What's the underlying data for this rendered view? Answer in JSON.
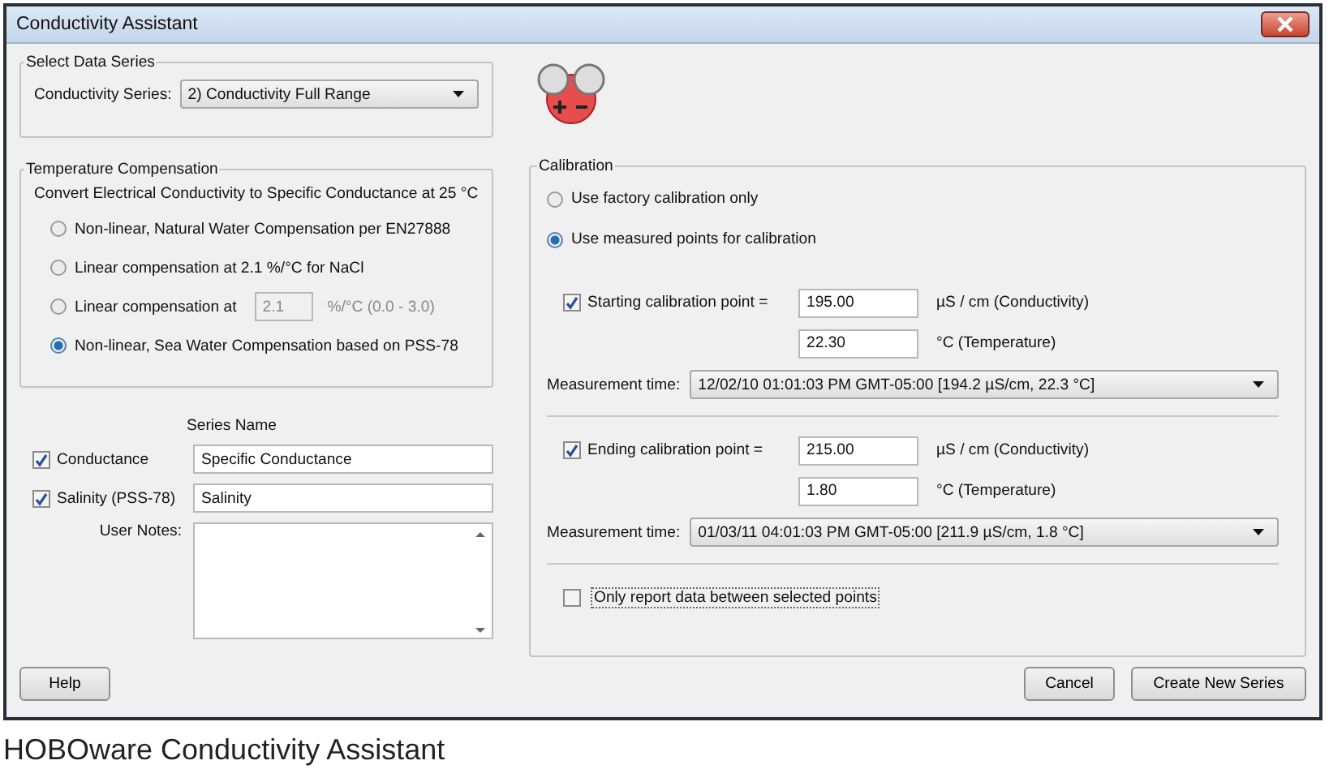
{
  "window": {
    "title": "Conductivity Assistant"
  },
  "select_data_series": {
    "title": "Select Data Series",
    "label": "Conductivity Series:",
    "value": "2) Conductivity Full Range"
  },
  "temperature_compensation": {
    "title": "Temperature Compensation",
    "description": "Convert Electrical Conductivity to Specific Conductance at 25 °C",
    "options": [
      {
        "kind": "plain",
        "label": "Non-linear, Natural Water Compensation per EN27888",
        "selected": false
      },
      {
        "kind": "plain",
        "label": "Linear compensation at 2.1 %/°C for NaCl",
        "selected": false
      },
      {
        "kind": "input",
        "label": "Linear compensation at",
        "value": "2.1",
        "unit": "%/°C  (0.0 - 3.0)",
        "disabled": true,
        "selected": false
      },
      {
        "kind": "plain",
        "label": "Non-linear, Sea Water Compensation based on PSS-78",
        "selected": true
      }
    ]
  },
  "series": {
    "heading": "Series Name",
    "rows": [
      {
        "label": "Conductance",
        "checked": true,
        "value": "Specific Conductance"
      },
      {
        "label": "Salinity (PSS-78)",
        "checked": true,
        "value": "Salinity"
      }
    ],
    "notes_label": "User Notes:"
  },
  "calibration": {
    "title": "Calibration",
    "modes": [
      {
        "label": "Use factory calibration only",
        "selected": false
      },
      {
        "label": "Use measured points for calibration",
        "selected": true
      }
    ],
    "points": [
      {
        "label": "Starting calibration point =",
        "checked": true,
        "conductivity": "195.00",
        "conductivity_unit": "µS / cm (Conductivity)",
        "temperature": "22.30",
        "temperature_unit": "°C (Temperature)",
        "time_label": "Measurement time:",
        "time": "12/02/10 01:01:03 PM GMT-05:00 [194.2 µS/cm, 22.3 °C]"
      },
      {
        "label": "Ending calibration point =",
        "checked": true,
        "conductivity": "215.00",
        "conductivity_unit": "µS / cm (Conductivity)",
        "temperature": "1.80",
        "temperature_unit": "°C (Temperature)",
        "time_label": "Measurement time:",
        "time": "01/03/11 04:01:03 PM GMT-05:00 [211.9 µS/cm, 1.8 °C]"
      }
    ],
    "only_between": {
      "label": "Only report data between selected points",
      "checked": false
    }
  },
  "help_button": "Help",
  "buttons": [
    "Cancel",
    "Create New Series"
  ],
  "caption": "HOBOware Conductivity Assistant"
}
